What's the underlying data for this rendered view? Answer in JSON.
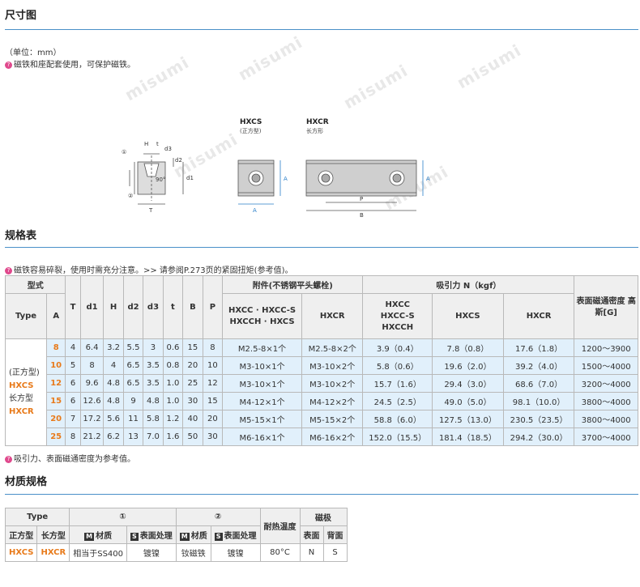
{
  "header": {
    "title": "尺寸图"
  },
  "notes": {
    "unit": "（单位：mm）",
    "tip1": "磁铁和座配套使用，可保护磁铁。"
  },
  "watermark": "misumi",
  "diagram": {
    "hxcs_label": "HXCS",
    "hxcs_sub": "(正方型)",
    "hxcr_label": "HXCR",
    "hxcr_sub": "长方形",
    "dims": {
      "h": "H",
      "t": "t",
      "d3": "d3",
      "d2": "d2",
      "d1": "d1",
      "T": "T",
      "ninety": "90°",
      "c1": "①",
      "c2": "②",
      "A": "A",
      "P": "P",
      "B": "B"
    }
  },
  "spec": {
    "title": "规格表",
    "note_before": "磁铁容易碎裂，使用时需充分注意。>> 请参阅P.273页的紧固扭矩(参考值)。",
    "headers": {
      "model": "型式",
      "type": "Type",
      "A": "A",
      "T": "T",
      "d1": "d1",
      "H": "H",
      "d2": "d2",
      "d3": "d3",
      "t": "t",
      "B": "B",
      "P": "P",
      "accessory": "附件(不锈钢平头螺栓)",
      "acc_col1": "HXCC · HXCC-S HXCCH · HXCS",
      "acc_col2": "HXCR",
      "pull": "吸引力 N（kgf）",
      "pull_col1": "HXCC HXCC-S HXCCH",
      "pull_col2": "HXCS",
      "pull_col3": "HXCR",
      "density": "表面磁通密度 高斯[G]"
    },
    "type_cell": {
      "line1": "(正方型)",
      "line2": "HXCS",
      "line3": "长方型",
      "line4": "HXCR"
    },
    "rows": [
      {
        "A": "8",
        "T": "4",
        "d1": "6.4",
        "H": "3.2",
        "d2": "5.5",
        "d3": "3",
        "t": "0.6",
        "B": "15",
        "P": "8",
        "acc1": "M2.5-8×1个",
        "acc2": "M2.5-8×2个",
        "p1": "3.9（0.4）",
        "p2": "7.8（0.8）",
        "p3": "17.6（1.8）",
        "g": "1200～3900"
      },
      {
        "A": "10",
        "T": "5",
        "d1": "8",
        "H": "4",
        "d2": "6.5",
        "d3": "3.5",
        "t": "0.8",
        "B": "20",
        "P": "10",
        "acc1": "M3-10×1个",
        "acc2": "M3-10×2个",
        "p1": "5.8（0.6）",
        "p2": "19.6（2.0）",
        "p3": "39.2（4.0）",
        "g": "1500～4000"
      },
      {
        "A": "12",
        "T": "6",
        "d1": "9.6",
        "H": "4.8",
        "d2": "6.5",
        "d3": "3.5",
        "t": "1.0",
        "B": "25",
        "P": "12",
        "acc1": "M3-10×1个",
        "acc2": "M3-10×2个",
        "p1": "15.7（1.6）",
        "p2": "29.4（3.0）",
        "p3": "68.6（7.0）",
        "g": "3200～4000"
      },
      {
        "A": "15",
        "T": "6",
        "d1": "12.6",
        "H": "4.8",
        "d2": "9",
        "d3": "4.8",
        "t": "1.0",
        "B": "30",
        "P": "15",
        "acc1": "M4-12×1个",
        "acc2": "M4-12×2个",
        "p1": "24.5（2.5）",
        "p2": "49.0（5.0）",
        "p3": "98.1（10.0）",
        "g": "3800～4000"
      },
      {
        "A": "20",
        "T": "7",
        "d1": "17.2",
        "H": "5.6",
        "d2": "11",
        "d3": "5.8",
        "t": "1.2",
        "B": "40",
        "P": "20",
        "acc1": "M5-15×1个",
        "acc2": "M5-15×2个",
        "p1": "58.8（6.0）",
        "p2": "127.5（13.0）",
        "p3": "230.5（23.5）",
        "g": "3800～4000"
      },
      {
        "A": "25",
        "T": "8",
        "d1": "21.2",
        "H": "6.2",
        "d2": "13",
        "d3": "7.0",
        "t": "1.6",
        "B": "50",
        "P": "30",
        "acc1": "M6-16×1个",
        "acc2": "M6-16×2个",
        "p1": "152.0（15.5）",
        "p2": "181.4（18.5）",
        "p3": "294.2（30.0）",
        "g": "3700～4000"
      }
    ],
    "note_after": "吸引力、表面磁通密度为参考值。"
  },
  "material": {
    "title": "材质规格",
    "headers": {
      "type": "Type",
      "c1": "①",
      "c2": "②",
      "heat": "耐热温度",
      "pole": "磁极",
      "square": "正方型",
      "rect": "长方型",
      "m": "M",
      "mat": "材质",
      "s": "S",
      "surf": "表面处理",
      "front": "表面",
      "back": "背面"
    },
    "row": {
      "square": "HXCS",
      "rect": "HXCR",
      "mat1": "相当于SS400",
      "surf1": "镀镍",
      "mat2": "钕磁铁",
      "surf2": "镀镍",
      "heat": "80°C",
      "front": "N",
      "back": "S"
    }
  }
}
